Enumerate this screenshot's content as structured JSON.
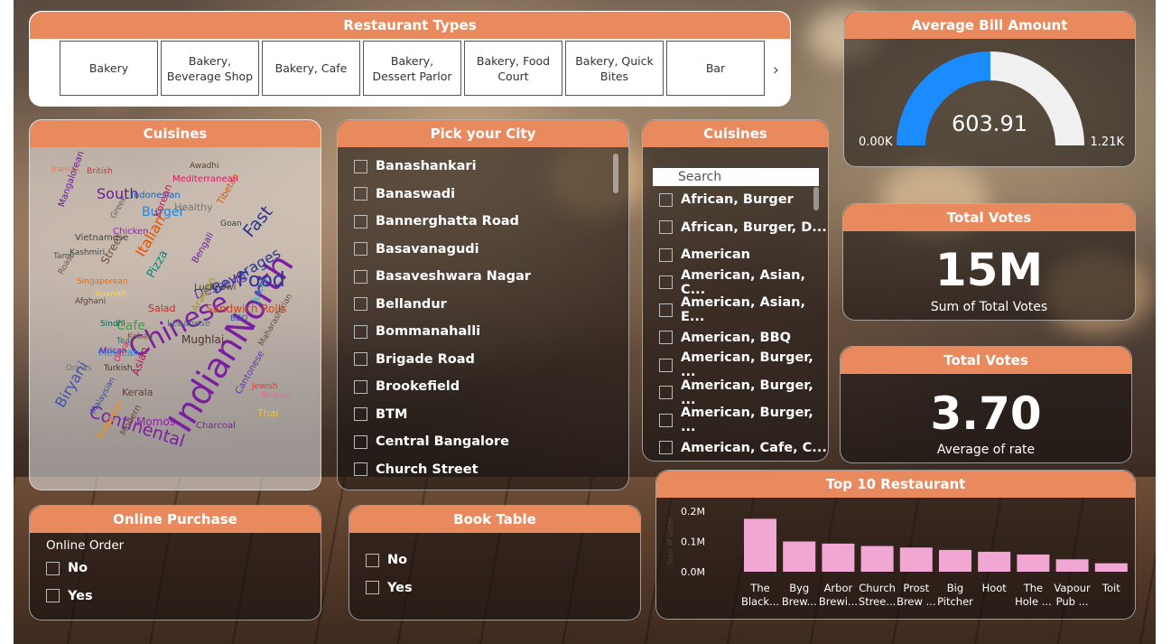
{
  "restaurant_types": {
    "title": "Restaurant Types",
    "tiles": [
      "Bakery",
      "Bakery, Beverage Shop",
      "Bakery, Cafe",
      "Bakery, Dessert Parlor",
      "Bakery, Food Court",
      "Bakery, Quick Bites",
      "Bar"
    ]
  },
  "avg_bill": {
    "title": "Average Bill Amount",
    "value": "603.91",
    "min": "0.00K",
    "max": "1.21K",
    "fraction": 0.5,
    "fill_color": "#1a8cff",
    "track_color": "#f0f0f0"
  },
  "total_votes_sum": {
    "title": "Total Votes",
    "value": "15M",
    "label": "Sum of Total Votes"
  },
  "total_votes_avg": {
    "title": "Total Votes",
    "value": "3.70",
    "label": "Average of rate"
  },
  "cuisines_cloud": {
    "title": "Cuisines",
    "words": [
      {
        "t": "Chinese",
        "c": "#7a1fa2"
      },
      {
        "t": "IndianNorth",
        "c": "#7a1fa2"
      },
      {
        "t": "Continental",
        "c": "#7a1fa2"
      },
      {
        "t": "Food",
        "c": "#283593"
      },
      {
        "t": "Fast",
        "c": "#283593"
      },
      {
        "t": "Beverages",
        "c": "#283593"
      },
      {
        "t": "Biryani",
        "c": "#3f51b5"
      },
      {
        "t": "South",
        "c": "#6a1b9a"
      },
      {
        "t": "Desserts",
        "c": "#5e35b1"
      },
      {
        "t": "Italian",
        "c": "#e65100"
      },
      {
        "t": "Burger",
        "c": "#1e88e5"
      },
      {
        "t": "Cafe",
        "c": "#43a047"
      },
      {
        "t": "Street",
        "c": "#6d4c41"
      },
      {
        "t": "Sandwich Rolls",
        "c": "#d84315"
      },
      {
        "t": "Momos",
        "c": "#8e24aa"
      },
      {
        "t": "Mughlai",
        "c": "#4e342e"
      },
      {
        "t": "Asian",
        "c": "#ad1457"
      },
      {
        "t": "Kerala",
        "c": "#5d4037"
      },
      {
        "t": "Mexican",
        "c": "#1e88e5"
      },
      {
        "t": "Pizza",
        "c": "#00897b"
      },
      {
        "t": "Healthy",
        "c": "#757575"
      },
      {
        "t": "Arabian",
        "c": "#9e9d24"
      },
      {
        "t": "Salad",
        "c": "#c62828"
      },
      {
        "t": "Thai",
        "c": "#fbc02d"
      },
      {
        "t": "Lebanese",
        "c": "#546e7a"
      },
      {
        "t": "Charcoal",
        "c": "#7b1fa2"
      },
      {
        "t": "European",
        "c": "#fb8c00"
      },
      {
        "t": "Modern",
        "c": "#6d4c41"
      },
      {
        "t": "Malaysian",
        "c": "#3949ab"
      },
      {
        "t": "Chicken",
        "c": "#8e24aa"
      },
      {
        "t": "Tibetan",
        "c": "#e65100"
      },
      {
        "t": "Indonesian",
        "c": "#1565c0"
      },
      {
        "t": "Mediterranean",
        "c": "#d81b60"
      },
      {
        "t": "British",
        "c": "#d32f2f"
      },
      {
        "t": "Iranian",
        "c": "#ff7043"
      },
      {
        "t": "Awadhi",
        "c": "#5d4037"
      },
      {
        "t": "Mangalorean",
        "c": "#6a1b9a"
      },
      {
        "t": "Vietnamese",
        "c": "#424242"
      },
      {
        "t": "Kashmiri",
        "c": "#37474f"
      },
      {
        "t": "Tamil",
        "c": "#455a64"
      },
      {
        "t": "Singaporean",
        "c": "#ef6c00"
      },
      {
        "t": "Spanish",
        "c": "#fdd835"
      },
      {
        "t": "Afghani",
        "c": "#5d4037"
      },
      {
        "t": "Sindhi",
        "c": "#00695c"
      },
      {
        "t": "African",
        "c": "#6a1b9a"
      },
      {
        "t": "Turkish",
        "c": "#4e342e"
      },
      {
        "t": "Drinks",
        "c": "#757575"
      },
      {
        "t": "Goan",
        "c": "#37474f"
      },
      {
        "t": "BBQ",
        "c": "#3949ab"
      },
      {
        "t": "Korean",
        "c": "#c2185b"
      },
      {
        "t": "Bengali",
        "c": "#6a1b9a"
      },
      {
        "t": "Lucknowi",
        "c": "#424242"
      },
      {
        "t": "Greek",
        "c": "#616161"
      },
      {
        "t": "Roast",
        "c": "#795548"
      },
      {
        "t": "Tea",
        "c": "#00838f"
      },
      {
        "t": "Juices",
        "c": "#00acc1"
      },
      {
        "t": "Maharashtrian",
        "c": "#6d4c41"
      },
      {
        "t": "Jewish",
        "c": "#e53935"
      },
      {
        "t": "Belgian",
        "c": "#f06292"
      },
      {
        "t": "Cantonese",
        "c": "#5e35b1"
      },
      {
        "t": "Kebab",
        "c": "#795548"
      },
      {
        "t": "Oriya",
        "c": "#e91e63"
      }
    ]
  },
  "city": {
    "title": "Pick your City",
    "items": [
      "Banashankari",
      "Banaswadi",
      "Bannerghatta Road",
      "Basavanagudi",
      "Basaveshwara Nagar",
      "Bellandur",
      "Bommanahalli",
      "Brigade Road",
      "Brookefield",
      "BTM",
      "Central Bangalore",
      "Church Street"
    ]
  },
  "cuisines_list": {
    "title": "Cuisines",
    "search_placeholder": "Search",
    "items": [
      "African, Burger",
      "African, Burger, D...",
      "American",
      "American, Asian, C...",
      "American, Asian, E...",
      "American, BBQ",
      "American, Burger, ...",
      "American, Burger, ...",
      "American, Burger, ...",
      "American, Cafe, C..."
    ]
  },
  "online_purchase": {
    "title": "Online Purchase",
    "label": "Online Order",
    "items": [
      "No",
      "Yes"
    ]
  },
  "book_table": {
    "title": "Book Table",
    "items": [
      "No",
      "Yes"
    ]
  },
  "chart_data": {
    "type": "bar",
    "title": "Top 10 Restaurant",
    "ylabel": "Sum of votes",
    "xlabel": "",
    "yticks": [
      "0.2M",
      "0.1M",
      "0.0M"
    ],
    "ylim": [
      0,
      0.2
    ],
    "categories": [
      "The Black...",
      "Byg Brew...",
      "Arbor Brewi...",
      "Church Stree...",
      "Prost Brew ...",
      "Big Pitcher",
      "Hoot",
      "The Hole ...",
      "Vapour Pub ...",
      "Toit"
    ],
    "values": [
      0.175,
      0.1,
      0.093,
      0.085,
      0.08,
      0.072,
      0.066,
      0.057,
      0.041,
      0.028
    ],
    "color": "#f0a7d4"
  }
}
